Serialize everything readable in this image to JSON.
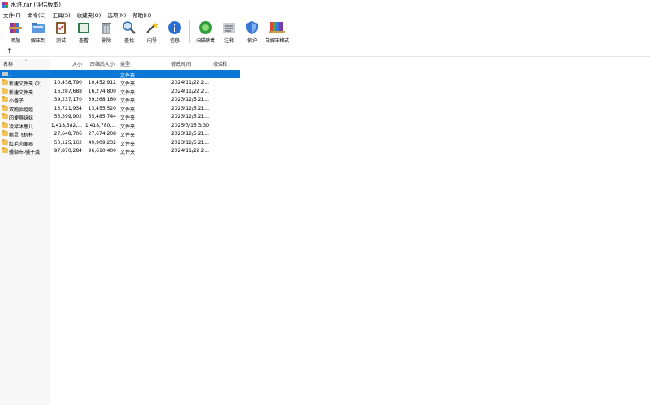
{
  "window": {
    "title": "水浒.rar (评估版本)"
  },
  "menu": [
    "文件(F)",
    "命令(C)",
    "工具(S)",
    "收藏夹(O)",
    "选项(N)",
    "帮助(H)"
  ],
  "toolbar": [
    {
      "label": "添加",
      "icon": "books-add-icon"
    },
    {
      "label": "解压到",
      "icon": "folder-extract-icon"
    },
    {
      "label": "测试",
      "icon": "clipboard-test-icon"
    },
    {
      "label": "查看",
      "icon": "book-view-icon"
    },
    {
      "label": "删除",
      "icon": "trash-icon"
    },
    {
      "label": "查找",
      "icon": "magnifier-icon"
    },
    {
      "label": "向导",
      "icon": "wand-icon"
    },
    {
      "label": "信息",
      "icon": "info-icon"
    },
    {
      "label": "扫描病毒",
      "icon": "virus-scan-icon"
    },
    {
      "label": "注释",
      "icon": "comment-icon"
    },
    {
      "label": "保护",
      "icon": "shield-icon"
    },
    {
      "label": "自解压格式",
      "icon": "sfx-icon"
    }
  ],
  "pathbar": {
    "up": "↑"
  },
  "columns": {
    "name": "名称",
    "size": "大小",
    "packed": "压缩后大小",
    "type": "类型",
    "modified": "修改时间",
    "crc": "校验和"
  },
  "rows": [
    {
      "name": "..",
      "size": "",
      "packed": "",
      "type": "文件夹",
      "modified": "",
      "selected": true,
      "updir": true
    },
    {
      "name": "新建文件夹 (2)",
      "size": "10,438,790",
      "packed": "10,452,912",
      "type": "文件夹",
      "modified": "2024/11/22 2..."
    },
    {
      "name": "新建文件夹",
      "size": "16,287,688",
      "packed": "16,274,800",
      "type": "文件夹",
      "modified": "2024/11/22 2..."
    },
    {
      "name": "小番子",
      "size": "39,237,170",
      "packed": "39,268,160",
      "type": "文件夹",
      "modified": "2023/12/5 21..."
    },
    {
      "name": "双胞胎姐姐",
      "size": "13,721,934",
      "packed": "13,455,520",
      "type": "文件夹",
      "modified": "2023/12/5 21..."
    },
    {
      "name": "肉便器妹妹",
      "size": "55,399,902",
      "packed": "55,485,744",
      "type": "文件夹",
      "modified": "2023/12/5 21..."
    },
    {
      "name": "凌琴沐葱儿",
      "size": "1,418,582,...",
      "packed": "1,418,780,...",
      "type": "文件夹",
      "modified": "2025/7/15 3:30"
    },
    {
      "name": "精灵飞机杯",
      "size": "27,648,706",
      "packed": "27,674,208",
      "type": "文件夹",
      "modified": "2023/12/5 21..."
    },
    {
      "name": "红毛肉便器",
      "size": "50,125,162",
      "packed": "49,909,232",
      "type": "文件夹",
      "modified": "2023/12/5 21..."
    },
    {
      "name": "骚御市-骚子龚",
      "size": "97,870,284",
      "packed": "96,610,400",
      "type": "文件夹",
      "modified": "2024/11/22 2..."
    }
  ],
  "colors": {
    "selection": "#0a78d7",
    "folder": "#f2c55c"
  }
}
